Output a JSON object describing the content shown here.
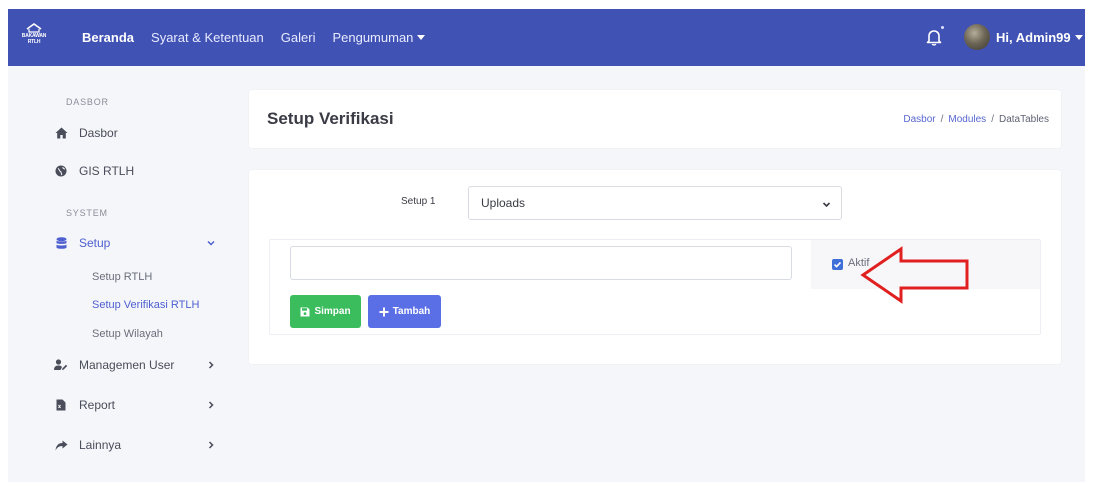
{
  "brand": {
    "line1": "BAKAWAN",
    "line2": "RTLH"
  },
  "topnav": {
    "items": [
      {
        "label": "Beranda"
      },
      {
        "label": "Syarat & Ketentuan"
      },
      {
        "label": "Galeri"
      },
      {
        "label": "Pengumuman"
      }
    ],
    "user_greeting": "Hi, Admin99",
    "colors": {
      "bar": "#4152b5"
    }
  },
  "sidebar": {
    "heading_dasbor": "DASBOR",
    "heading_system": "SYSTEM",
    "items": [
      {
        "label": "Dasbor",
        "icon": "home-icon"
      },
      {
        "label": "GIS RTLH",
        "icon": "globe-icon"
      },
      {
        "label": "Setup",
        "icon": "database-icon"
      },
      {
        "label": "Managemen User",
        "icon": "user-edit-icon"
      },
      {
        "label": "Report",
        "icon": "file-icon"
      },
      {
        "label": "Lainnya",
        "icon": "share-icon"
      }
    ],
    "subitems": [
      {
        "label": "Setup RTLH"
      },
      {
        "label": "Setup Verifikasi RTLH"
      },
      {
        "label": "Setup Wilayah"
      }
    ]
  },
  "page": {
    "title": "Setup Verifikasi",
    "breadcrumb": [
      "Dasbor",
      "Modules",
      "DataTables"
    ]
  },
  "form": {
    "setup_label": "Setup 1",
    "select_value": "Uploads",
    "text_value": "",
    "aktif_label": "Aktif",
    "aktif_checked": true,
    "save_label": "Simpan",
    "add_label": "Tambah"
  },
  "colors": {
    "accent": "#4e5fd0",
    "save": "#3bbc5d",
    "add": "#5a6fe6",
    "annotation_arrow": "#e02020"
  }
}
